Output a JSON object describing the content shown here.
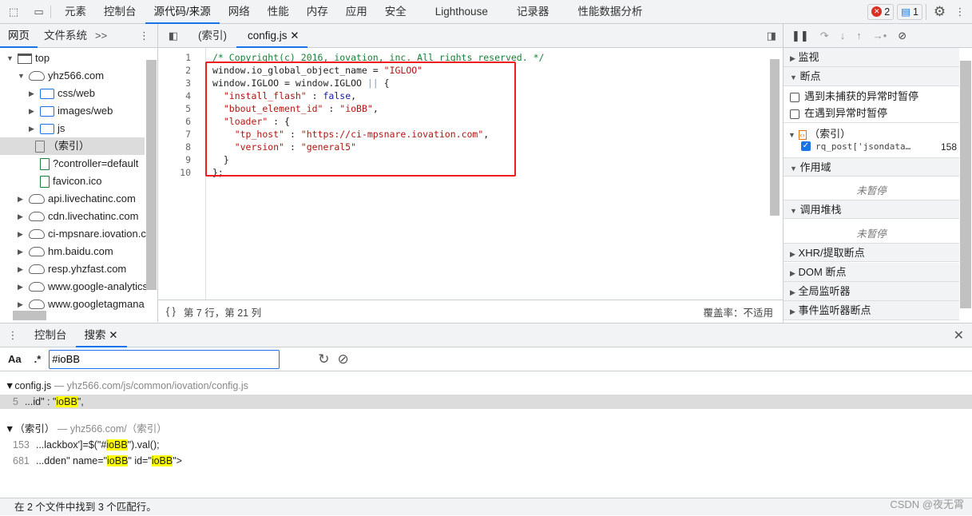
{
  "topbar": {
    "tabs": [
      "元素",
      "控制台",
      "源代码/来源",
      "网络",
      "性能",
      "内存",
      "应用",
      "安全",
      "Lighthouse",
      "记录器",
      "性能数据分析"
    ],
    "active": "源代码/来源",
    "errors": "2",
    "messages": "1"
  },
  "navigator": {
    "tabs": [
      "网页",
      "文件系统"
    ],
    "more": ">>"
  },
  "editor_tabs": [
    "(索引)",
    "config.js"
  ],
  "tree": [
    {
      "label": "top",
      "depth": 0,
      "icon": "frame-icon",
      "expanded": true
    },
    {
      "label": "yhz566.com",
      "depth": 1,
      "icon": "cloud-icon",
      "expanded": true
    },
    {
      "label": "css/web",
      "depth": 2,
      "icon": "folder-icon"
    },
    {
      "label": "images/web",
      "depth": 2,
      "icon": "folder-icon"
    },
    {
      "label": "js",
      "depth": 2,
      "icon": "folder-icon"
    },
    {
      "label": "（索引）",
      "depth": 3,
      "icon": "file-icon",
      "selected": true
    },
    {
      "label": "?controller=default",
      "depth": 3,
      "icon": "file-green-icon"
    },
    {
      "label": "favicon.ico",
      "depth": 3,
      "icon": "file-green-icon"
    },
    {
      "label": "api.livechatinc.com",
      "depth": 1,
      "icon": "cloud-icon"
    },
    {
      "label": "cdn.livechatinc.com",
      "depth": 1,
      "icon": "cloud-icon"
    },
    {
      "label": "ci-mpsnare.iovation.c",
      "depth": 1,
      "icon": "cloud-icon"
    },
    {
      "label": "hm.baidu.com",
      "depth": 1,
      "icon": "cloud-icon"
    },
    {
      "label": "resp.yhzfast.com",
      "depth": 1,
      "icon": "cloud-icon"
    },
    {
      "label": "www.google-analytics",
      "depth": 1,
      "icon": "cloud-icon"
    },
    {
      "label": "www.googletagmana",
      "depth": 1,
      "icon": "cloud-icon"
    }
  ],
  "code": [
    "/* Copyright(c) 2016, iovation, inc. All rights reserved. */",
    "window.io_global_object_name = \"IGLOO\"",
    "window.IGLOO = window.IGLOO || {",
    "  \"install_flash\" : false,",
    "  \"bbout_element_id\" : \"ioBB\",",
    "  \"loader\" : {",
    "    \"tp_host\" : \"https://ci-mpsnare.iovation.com\",",
    "    \"version\" : \"general5\"",
    "  }",
    "};"
  ],
  "status": {
    "position": "第 7 行，第 21 列",
    "coverage": "覆盖率：不适用"
  },
  "debugger": {
    "watch": "监视",
    "breakpoints": "断点",
    "pause_uncaught": "遇到未捕获的异常时暂停",
    "pause_caught": "在遇到异常时暂停",
    "bp_file": "（索引）",
    "bp_code": "rq_post['jsondata…",
    "bp_line": "158",
    "scope": "作用域",
    "not_paused": "未暂停",
    "callstack": "调用堆栈",
    "xhr": "XHR/提取断点",
    "dom": "DOM 断点",
    "global": "全局监听器",
    "event": "事件监听器断点"
  },
  "drawer": {
    "tabs": [
      "控制台",
      "搜索"
    ],
    "query": "#ioBB",
    "aa": "Aa",
    "regex": ".*"
  },
  "results": [
    {
      "file": "config.js",
      "path": "yhz566.com/js/common/iovation/config.js",
      "matches": [
        {
          "line": "5",
          "pre": "...id\" : \"",
          "hit": "ioBB",
          "post": "\","
        }
      ]
    },
    {
      "file": "（索引）",
      "path": "yhz566.com/（索引）",
      "matches": [
        {
          "line": "153",
          "pre": "...lackbox']=$(\"#",
          "hit": "ioBB",
          "post": "\").val();"
        },
        {
          "line": "681",
          "pre": "...dden\" name=\"",
          "hit": "ioBB",
          "mid": "\" id=\"",
          "hit2": "ioBB",
          "post": "\">"
        }
      ]
    }
  ],
  "footer": "在 2 个文件中找到 3 个匹配行。",
  "watermark": "CSDN @夜无霄"
}
